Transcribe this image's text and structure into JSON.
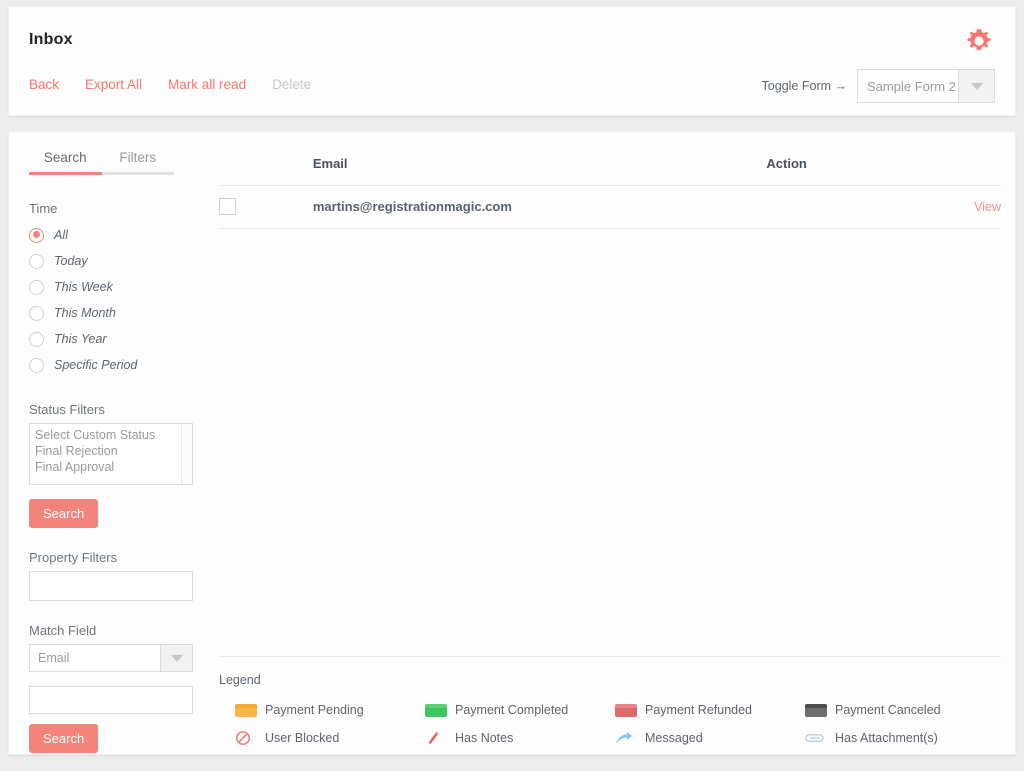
{
  "header": {
    "title": "Inbox",
    "gear_icon": "gear-icon",
    "actions": [
      {
        "label": "Back",
        "disabled": false
      },
      {
        "label": "Export All",
        "disabled": false
      },
      {
        "label": "Mark all read",
        "disabled": false
      },
      {
        "label": "Delete",
        "disabled": true
      }
    ],
    "toggle_form_label": "Toggle Form →",
    "form_select": {
      "value": "Sample Form 2",
      "caret_icon": "chevron-down-icon"
    }
  },
  "sidebar": {
    "tabs": [
      {
        "label": "Search",
        "active": true
      },
      {
        "label": "Filters",
        "active": false
      }
    ],
    "time": {
      "label": "Time",
      "options": [
        {
          "label": "All",
          "checked": true
        },
        {
          "label": "Today",
          "checked": false
        },
        {
          "label": "This Week",
          "checked": false
        },
        {
          "label": "This Month",
          "checked": false
        },
        {
          "label": "This Year",
          "checked": false
        },
        {
          "label": "Specific Period",
          "checked": false
        }
      ]
    },
    "status_filters": {
      "label": "Status Filters",
      "options": [
        "Select Custom Status",
        "Final Rejection",
        "Final Approval"
      ]
    },
    "search_button_1": "Search",
    "property_filters": {
      "label": "Property Filters",
      "value": "",
      "placeholder": ""
    },
    "match_field": {
      "label": "Match Field",
      "selected": "Email",
      "caret_icon": "chevron-down-icon",
      "value": "",
      "placeholder": ""
    },
    "search_button_2": "Search"
  },
  "table": {
    "columns": [
      "",
      "Email",
      "Action"
    ],
    "rows": [
      {
        "checked": false,
        "email": "martins@registrationmagic.com",
        "action": "View"
      }
    ]
  },
  "legend": {
    "title": "Legend",
    "items": [
      {
        "label": "Payment Pending",
        "icon": "payment-pending-swatch",
        "color": "#fbb44a",
        "kind": "swatch",
        "class": "sw-pending"
      },
      {
        "label": "Payment Completed",
        "icon": "payment-completed-swatch",
        "color": "#3fc55f",
        "kind": "swatch",
        "class": "sw-completed"
      },
      {
        "label": "Payment Refunded",
        "icon": "payment-refunded-swatch",
        "color": "#e06a6a",
        "kind": "swatch",
        "class": "sw-refunded"
      },
      {
        "label": "Payment Canceled",
        "icon": "payment-canceled-swatch",
        "color": "#6f6f6f",
        "kind": "swatch",
        "class": "sw-canceled"
      },
      {
        "label": "User Blocked",
        "icon": "user-blocked-icon",
        "color": "#f07070",
        "kind": "icon"
      },
      {
        "label": "Has Notes",
        "icon": "pencil-note-icon",
        "color": "#e8605c",
        "kind": "icon"
      },
      {
        "label": "Messaged",
        "icon": "reply-arrow-icon",
        "color": "#7fc8ea",
        "kind": "icon"
      },
      {
        "label": "Has Attachment(s)",
        "icon": "paperclip-icon",
        "color": "#b9c8ea",
        "kind": "icon"
      }
    ]
  },
  "colors": {
    "accent": "#f4837c",
    "link": "#f8776f",
    "page_bg": "#ededed",
    "card_bg": "#fdfdfd"
  }
}
